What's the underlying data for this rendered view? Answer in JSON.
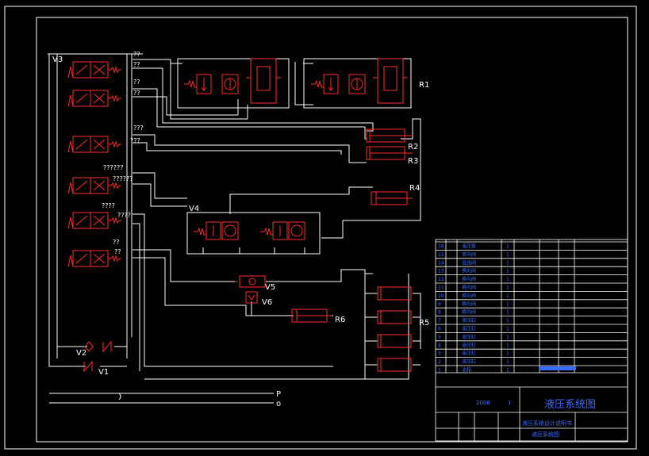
{
  "labels": {
    "v1": "V1",
    "v2": "V2",
    "v3": "V3",
    "v4": "V4",
    "v5": "V5",
    "v6": "V6",
    "r1": "R1",
    "r2": "R2",
    "r3": "R3",
    "r4": "R4",
    "r5": "R5",
    "r6": "R6",
    "p": "P",
    "o": "o"
  },
  "valve_annotations": [
    "??",
    "??",
    "??",
    "??",
    "???",
    "???",
    "??????",
    "??????",
    "????",
    "????",
    "??",
    "??"
  ],
  "title_block": {
    "title": "液压系统图",
    "rows": [
      "液压泵",
      "单向阀",
      "溢流阀",
      "换向阀",
      "换向阀",
      "换向阀",
      "换向阀",
      "换向阀",
      "换向阀",
      "液压缸",
      "液压缸",
      "液压缸",
      "液压缸",
      "液压缸",
      "液压缸",
      "油箱"
    ],
    "qty": [
      "1",
      "1",
      "1",
      "1",
      "1",
      "1",
      "1",
      "1",
      "1",
      "1",
      "1",
      "1",
      "1",
      "1",
      "1",
      "1"
    ],
    "unit": "液压系统设计说明书",
    "drawing_no": "液压系统图",
    "ratio": "2008",
    "sheet": "1"
  },
  "colors": {
    "lines": "#ffffff",
    "components": "#ff2a2a",
    "title_block": "#3a6bff"
  }
}
